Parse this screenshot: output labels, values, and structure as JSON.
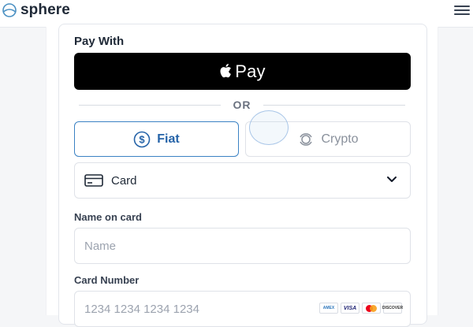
{
  "header": {
    "brand": "sphere"
  },
  "form": {
    "pay_with_label": "Pay With",
    "apple_pay_label": "Pay",
    "divider_text": "OR",
    "tabs": [
      {
        "label": "Fiat",
        "selected": true
      },
      {
        "label": "Crypto",
        "selected": false
      }
    ],
    "method_select": {
      "value": "Card"
    },
    "name_field": {
      "label": "Name on card",
      "placeholder": "Name",
      "value": ""
    },
    "card_number_field": {
      "label": "Card Number",
      "placeholder": "1234 1234 1234 1234",
      "value": ""
    },
    "accepted_brands": [
      "amex-icon",
      "visa-icon",
      "mastercard-icon",
      "discover-icon"
    ],
    "brand_labels": {
      "amex": "AMEX",
      "visa": "VISA",
      "discover": "DISCOVER"
    }
  },
  "colors": {
    "accent": "#3b82c4",
    "apple_pay_bg": "#000000"
  }
}
